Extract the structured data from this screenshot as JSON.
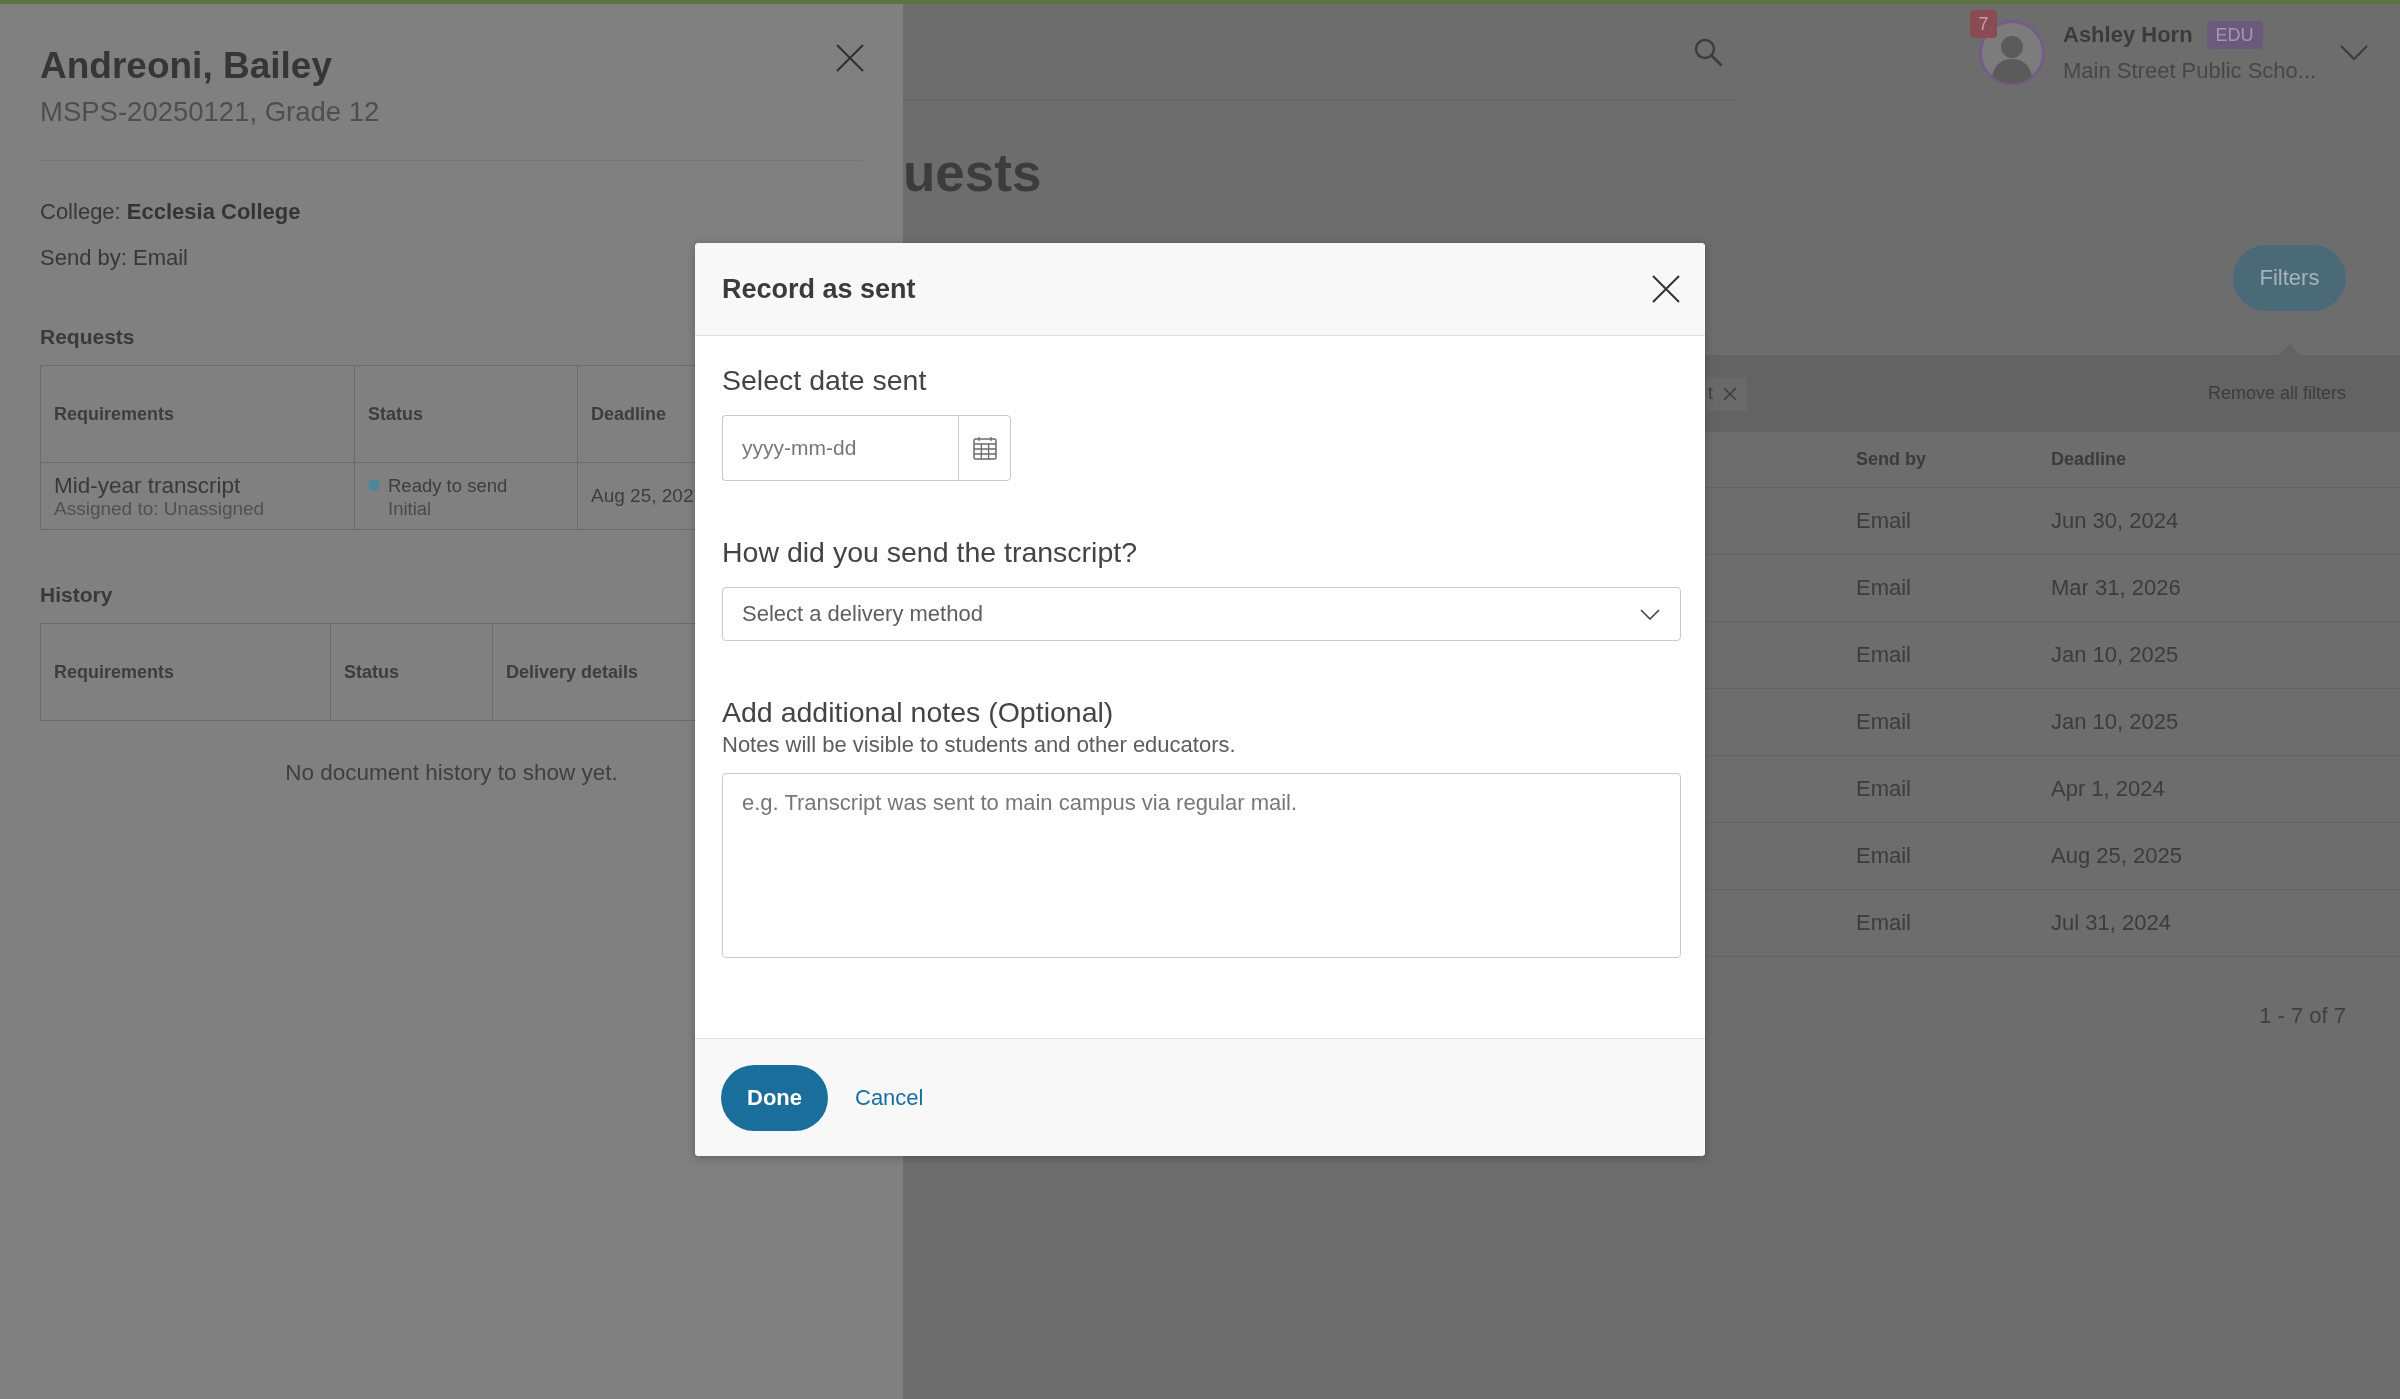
{
  "drawer": {
    "title": "Andreoni, Bailey",
    "subtitle": "MSPS-20250121, Grade 12",
    "college": "College: **Ecclesia College**",
    "send_by": "Send by: Email",
    "requests": {
      "heading": "Requests",
      "columns": [
        "Requirements",
        "Status",
        "Deadline"
      ],
      "rows": [
        {
          "requirement": "Mid-year transcript",
          "assigned": "Assigned to: Unassigned",
          "status": "Ready to send",
          "status_detail": "Initial",
          "color": "#4d8899",
          "deadline": "Aug 25, 202"
        }
      ]
    },
    "history": {
      "heading": "History",
      "columns": [
        "Requirements",
        "Status",
        "Delivery details"
      ],
      "empty_message": "No document history to show yet."
    }
  },
  "page": {
    "user": {
      "notification_count": "7",
      "name": "Ashley Horn",
      "role": "EDU",
      "school": "Main Street Public Scho..."
    },
    "title": "uests",
    "filters_button": "Filters",
    "filter_chips": [
      {
        "label": "t"
      }
    ],
    "remove_filters": "Remove all filters",
    "table": {
      "columns": [
        "Send by",
        "Deadline"
      ],
      "rows": [
        {
          "send_by": "Email",
          "deadline": "Jun 30, 2024"
        },
        {
          "send_by": "Email",
          "deadline": "Mar 31, 2026"
        },
        {
          "send_by": "Email",
          "deadline": "Jan 10, 2025"
        },
        {
          "send_by": "Email",
          "deadline": "Jan 10, 2025"
        },
        {
          "send_by": "Email",
          "deadline": "Apr 1, 2024"
        },
        {
          "send_by": "Email",
          "deadline": "Aug 25, 2025"
        },
        {
          "send_by": "Email",
          "deadline": "Jul 31, 2024"
        }
      ]
    },
    "pagination": "1 - 7 of 7"
  },
  "dialog": {
    "title": "Record as sent",
    "fields": [
      {
        "kind": "date",
        "label": "Select date sent",
        "placeholder": "yyyy-mm-dd"
      },
      {
        "kind": "select",
        "label": "How did you send the transcript?",
        "placeholder": "Select a delivery method"
      },
      {
        "kind": "textarea",
        "label": "Add additional notes (Optional)",
        "hint": "Notes will be visible to students and other educators.",
        "placeholder": "e.g. Transcript was sent to main campus via regular mail."
      }
    ],
    "buttons": [
      {
        "kind": "primary",
        "label": "Done"
      },
      {
        "kind": "link",
        "label": "Cancel"
      }
    ]
  }
}
